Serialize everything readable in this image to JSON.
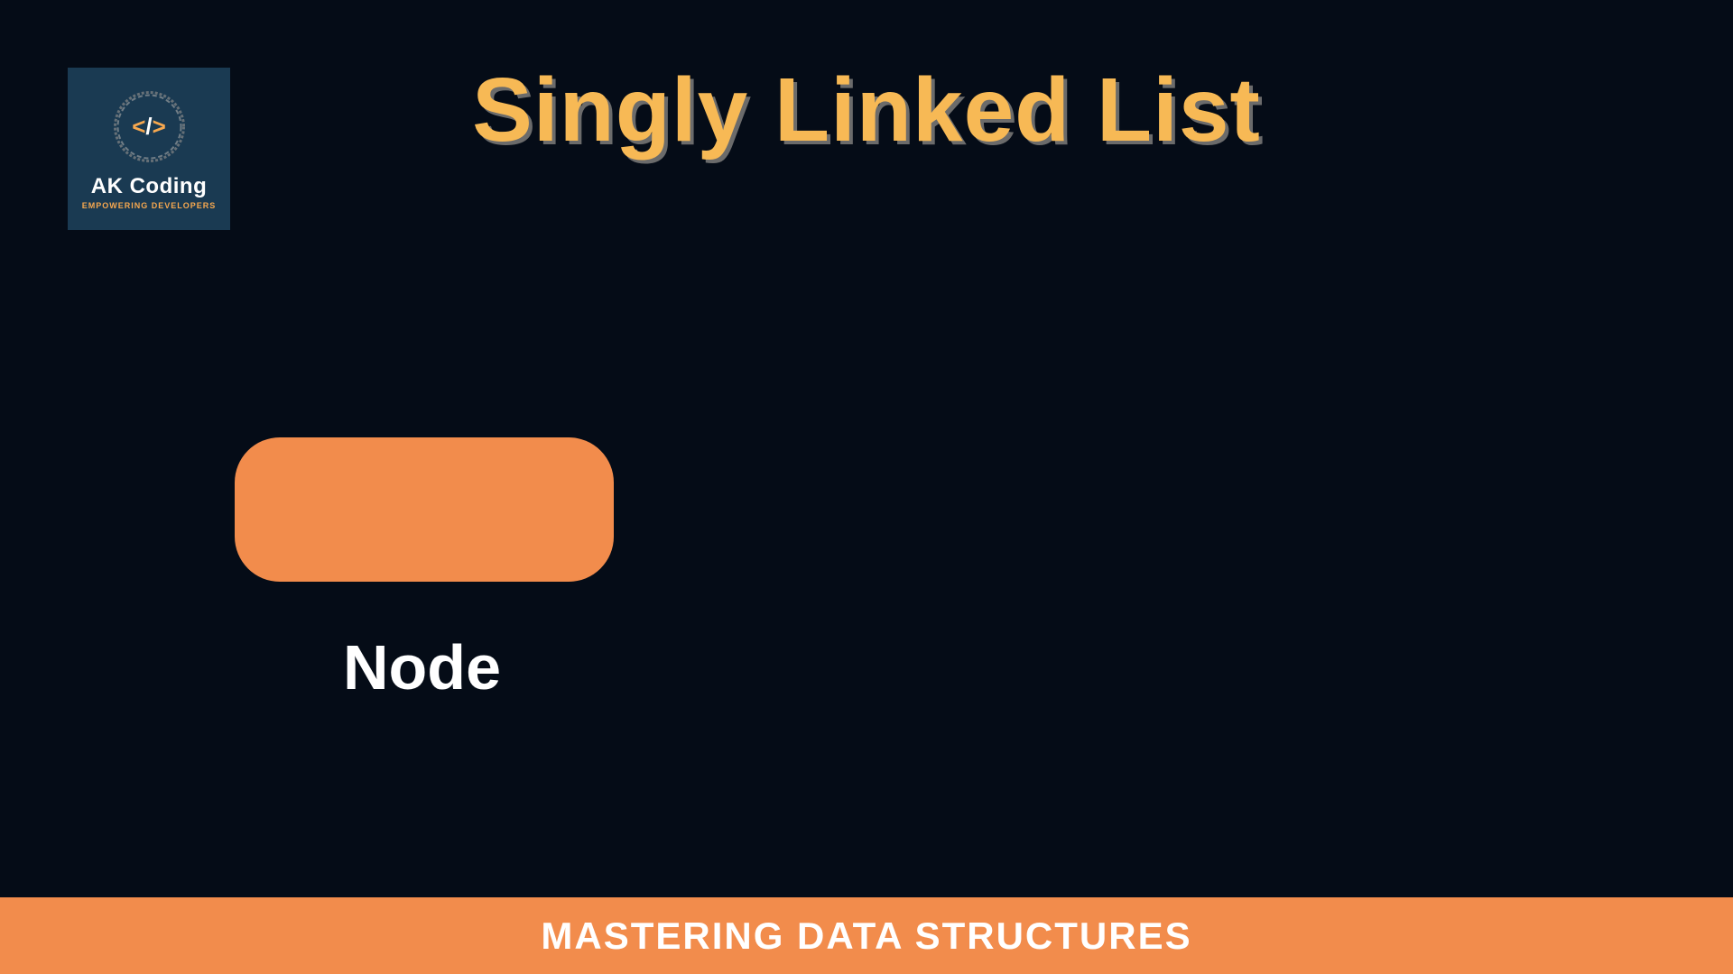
{
  "logo": {
    "title": "AK Coding",
    "subtitle": "EMPOWERING DEVELOPERS",
    "code_left": "<",
    "code_slash": "/",
    "code_right": ">"
  },
  "title": "Singly Linked List",
  "diagram": {
    "node_label": "Node"
  },
  "footer": "MASTERING DATA STRUCTURES"
}
